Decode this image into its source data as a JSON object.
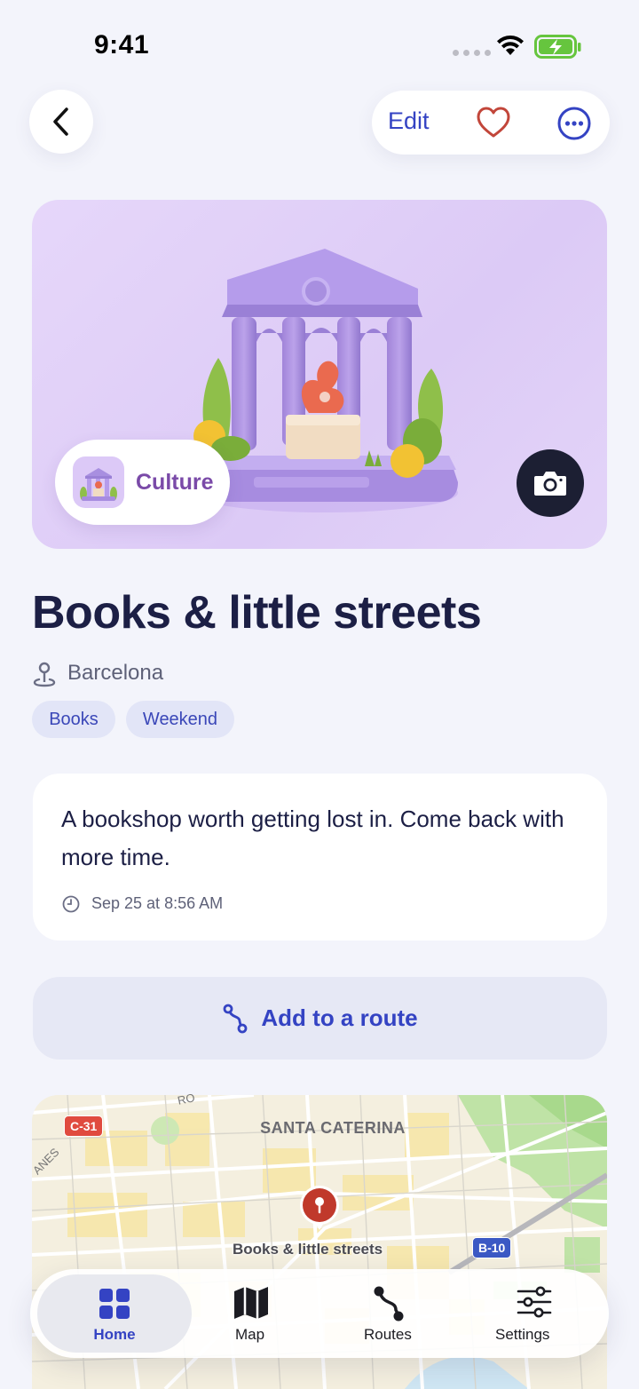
{
  "status_bar": {
    "time": "9:41"
  },
  "header": {
    "edit_label": "Edit"
  },
  "hero": {
    "category": "Culture"
  },
  "place": {
    "title": "Books & little streets",
    "location": "Barcelona",
    "tags": [
      "Books",
      "Weekend"
    ]
  },
  "note": {
    "text": "A bookshop worth getting lost in. Come back with more time.",
    "timestamp": "Sep 25 at 8:56 AM"
  },
  "route_button": {
    "label": "Add to a route"
  },
  "map": {
    "district": "SANTA CATERINA",
    "place_label": "Books & little streets",
    "road_badges": [
      "C-31",
      "B-10"
    ],
    "fragments": [
      "RO",
      "ANES"
    ]
  },
  "tabbar": {
    "items": [
      {
        "label": "Home",
        "icon": "grid-icon",
        "active": true
      },
      {
        "label": "Map",
        "icon": "map-icon",
        "active": false
      },
      {
        "label": "Routes",
        "icon": "route-icon",
        "active": false
      },
      {
        "label": "Settings",
        "icon": "sliders-icon",
        "active": false
      }
    ]
  },
  "colors": {
    "accent": "#3443c3",
    "culture": "#7a4aa8",
    "heart": "#c2463a",
    "pin": "#c0392b"
  }
}
